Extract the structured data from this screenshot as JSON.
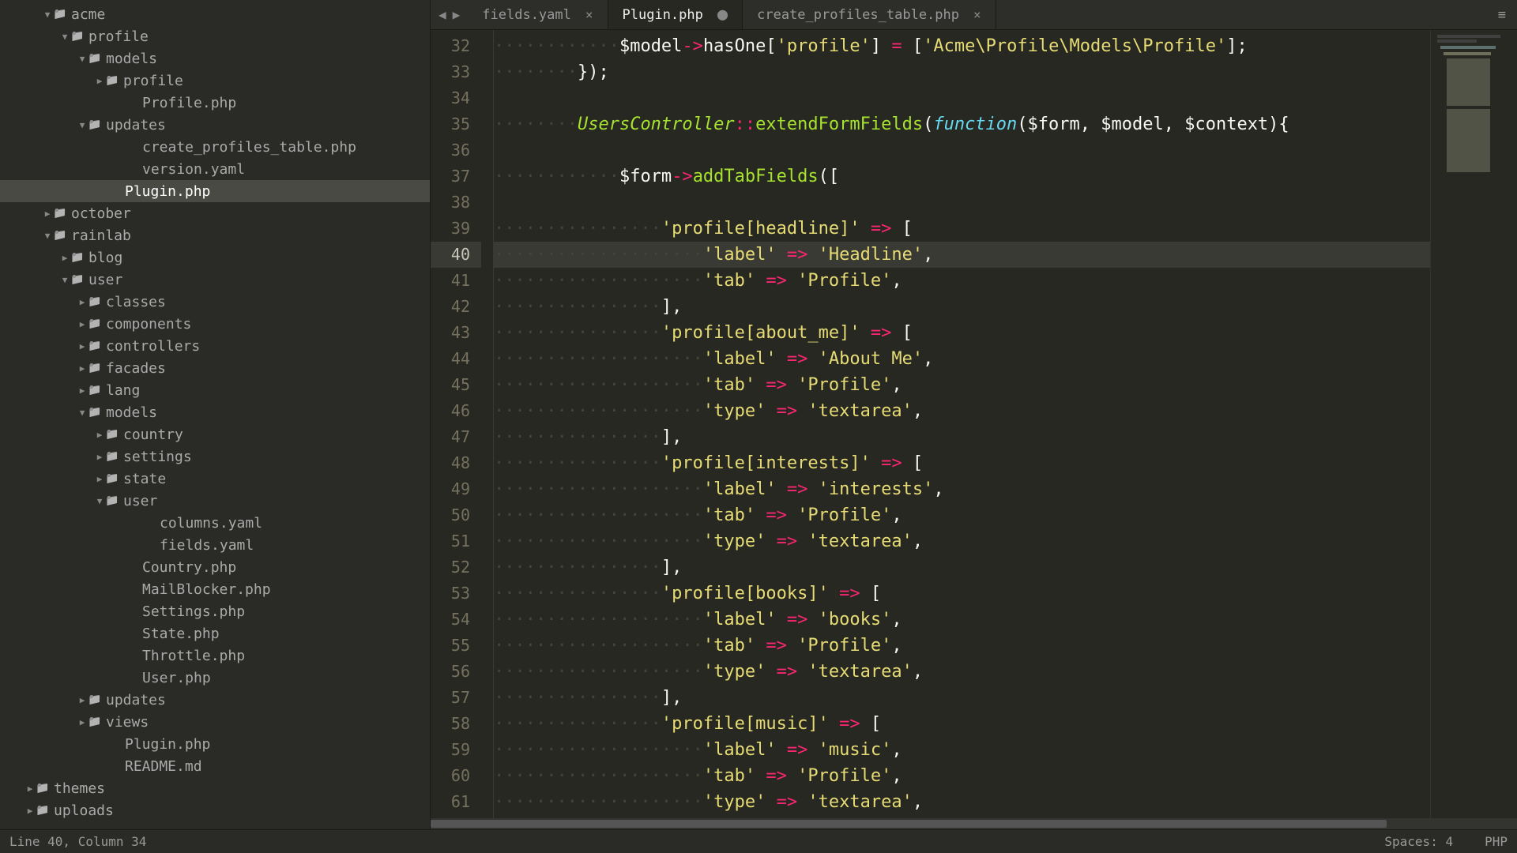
{
  "tabs": [
    {
      "label": "fields.yaml",
      "active": false,
      "dirty": false
    },
    {
      "label": "Plugin.php",
      "active": true,
      "dirty": true
    },
    {
      "label": "create_profiles_table.php",
      "active": false,
      "dirty": false
    }
  ],
  "tree": [
    {
      "indent": 54,
      "arrow": "▼",
      "type": "folder",
      "label": "acme"
    },
    {
      "indent": 76,
      "arrow": "▼",
      "type": "folder",
      "label": "profile"
    },
    {
      "indent": 98,
      "arrow": "▼",
      "type": "folder",
      "label": "models"
    },
    {
      "indent": 120,
      "arrow": "▶",
      "type": "folder",
      "label": "profile"
    },
    {
      "indent": 164,
      "arrow": "",
      "type": "file",
      "label": "Profile.php"
    },
    {
      "indent": 98,
      "arrow": "▼",
      "type": "folder",
      "label": "updates"
    },
    {
      "indent": 164,
      "arrow": "",
      "type": "file",
      "label": "create_profiles_table.php"
    },
    {
      "indent": 164,
      "arrow": "",
      "type": "file",
      "label": "version.yaml"
    },
    {
      "indent": 142,
      "arrow": "",
      "type": "file",
      "label": "Plugin.php",
      "selected": true
    },
    {
      "indent": 54,
      "arrow": "▶",
      "type": "folder",
      "label": "october"
    },
    {
      "indent": 54,
      "arrow": "▼",
      "type": "folder",
      "label": "rainlab"
    },
    {
      "indent": 76,
      "arrow": "▶",
      "type": "folder",
      "label": "blog"
    },
    {
      "indent": 76,
      "arrow": "▼",
      "type": "folder",
      "label": "user"
    },
    {
      "indent": 98,
      "arrow": "▶",
      "type": "folder",
      "label": "classes"
    },
    {
      "indent": 98,
      "arrow": "▶",
      "type": "folder",
      "label": "components"
    },
    {
      "indent": 98,
      "arrow": "▶",
      "type": "folder",
      "label": "controllers"
    },
    {
      "indent": 98,
      "arrow": "▶",
      "type": "folder",
      "label": "facades"
    },
    {
      "indent": 98,
      "arrow": "▶",
      "type": "folder",
      "label": "lang"
    },
    {
      "indent": 98,
      "arrow": "▼",
      "type": "folder",
      "label": "models"
    },
    {
      "indent": 120,
      "arrow": "▶",
      "type": "folder",
      "label": "country"
    },
    {
      "indent": 120,
      "arrow": "▶",
      "type": "folder",
      "label": "settings"
    },
    {
      "indent": 120,
      "arrow": "▶",
      "type": "folder",
      "label": "state"
    },
    {
      "indent": 120,
      "arrow": "▼",
      "type": "folder",
      "label": "user"
    },
    {
      "indent": 186,
      "arrow": "",
      "type": "file",
      "label": "columns.yaml"
    },
    {
      "indent": 186,
      "arrow": "",
      "type": "file",
      "label": "fields.yaml"
    },
    {
      "indent": 164,
      "arrow": "",
      "type": "file",
      "label": "Country.php"
    },
    {
      "indent": 164,
      "arrow": "",
      "type": "file",
      "label": "MailBlocker.php"
    },
    {
      "indent": 164,
      "arrow": "",
      "type": "file",
      "label": "Settings.php"
    },
    {
      "indent": 164,
      "arrow": "",
      "type": "file",
      "label": "State.php"
    },
    {
      "indent": 164,
      "arrow": "",
      "type": "file",
      "label": "Throttle.php"
    },
    {
      "indent": 164,
      "arrow": "",
      "type": "file",
      "label": "User.php"
    },
    {
      "indent": 98,
      "arrow": "▶",
      "type": "folder",
      "label": "updates"
    },
    {
      "indent": 98,
      "arrow": "▶",
      "type": "folder",
      "label": "views"
    },
    {
      "indent": 142,
      "arrow": "",
      "type": "file",
      "label": "Plugin.php"
    },
    {
      "indent": 142,
      "arrow": "",
      "type": "file",
      "label": "README.md"
    },
    {
      "indent": 32,
      "arrow": "▶",
      "type": "folder",
      "label": "themes"
    },
    {
      "indent": 32,
      "arrow": "▶",
      "type": "folder",
      "label": "uploads"
    }
  ],
  "code_lines": [
    {
      "n": 32,
      "seg": [
        {
          "c": "ws",
          "t": "············"
        },
        {
          "c": "s-var",
          "t": "$model"
        },
        {
          "c": "s-op",
          "t": "->"
        },
        {
          "c": "s-var",
          "t": "hasOne["
        },
        {
          "c": "s-str",
          "t": "'profile'"
        },
        {
          "c": "s-var",
          "t": "] "
        },
        {
          "c": "s-op",
          "t": "="
        },
        {
          "c": "s-var",
          "t": " ["
        },
        {
          "c": "s-str",
          "t": "'Acme\\Profile\\Models\\Profile'"
        },
        {
          "c": "s-var",
          "t": "];"
        }
      ]
    },
    {
      "n": 33,
      "seg": [
        {
          "c": "ws",
          "t": "········"
        },
        {
          "c": "s-var",
          "t": "});"
        }
      ]
    },
    {
      "n": 34,
      "seg": [
        {
          "c": "ws",
          "t": ""
        }
      ]
    },
    {
      "n": 35,
      "seg": [
        {
          "c": "ws",
          "t": "········"
        },
        {
          "c": "s-class",
          "t": "UsersController"
        },
        {
          "c": "s-op",
          "t": "::"
        },
        {
          "c": "s-func",
          "t": "extendFormFields"
        },
        {
          "c": "s-var",
          "t": "("
        },
        {
          "c": "s-kw",
          "t": "function"
        },
        {
          "c": "s-var",
          "t": "($form, $model, $context){"
        }
      ]
    },
    {
      "n": 36,
      "seg": [
        {
          "c": "ws",
          "t": ""
        }
      ]
    },
    {
      "n": 37,
      "seg": [
        {
          "c": "ws",
          "t": "············"
        },
        {
          "c": "s-var",
          "t": "$form"
        },
        {
          "c": "s-op",
          "t": "->"
        },
        {
          "c": "s-func",
          "t": "addTabFields"
        },
        {
          "c": "s-var",
          "t": "(["
        }
      ]
    },
    {
      "n": 38,
      "seg": [
        {
          "c": "ws",
          "t": ""
        }
      ]
    },
    {
      "n": 39,
      "seg": [
        {
          "c": "ws",
          "t": "················"
        },
        {
          "c": "s-str",
          "t": "'profile[headline]'"
        },
        {
          "c": "s-var",
          "t": " "
        },
        {
          "c": "s-op",
          "t": "=>"
        },
        {
          "c": "s-var",
          "t": " ["
        }
      ]
    },
    {
      "n": 40,
      "hl": true,
      "seg": [
        {
          "c": "ws",
          "t": "····················"
        },
        {
          "c": "s-str",
          "t": "'label'"
        },
        {
          "c": "s-var",
          "t": " "
        },
        {
          "c": "s-op",
          "t": "=>"
        },
        {
          "c": "s-var",
          "t": " "
        },
        {
          "c": "s-str",
          "t": "'Headline'"
        },
        {
          "c": "s-var",
          "t": ","
        }
      ]
    },
    {
      "n": 41,
      "seg": [
        {
          "c": "ws",
          "t": "····················"
        },
        {
          "c": "s-str",
          "t": "'tab'"
        },
        {
          "c": "s-var",
          "t": " "
        },
        {
          "c": "s-op",
          "t": "=>"
        },
        {
          "c": "s-var",
          "t": " "
        },
        {
          "c": "s-str",
          "t": "'Profile'"
        },
        {
          "c": "s-var",
          "t": ","
        }
      ]
    },
    {
      "n": 42,
      "seg": [
        {
          "c": "ws",
          "t": "················"
        },
        {
          "c": "s-var",
          "t": "],"
        }
      ]
    },
    {
      "n": 43,
      "seg": [
        {
          "c": "ws",
          "t": "················"
        },
        {
          "c": "s-str",
          "t": "'profile[about_me]'"
        },
        {
          "c": "s-var",
          "t": " "
        },
        {
          "c": "s-op",
          "t": "=>"
        },
        {
          "c": "s-var",
          "t": " ["
        }
      ]
    },
    {
      "n": 44,
      "seg": [
        {
          "c": "ws",
          "t": "····················"
        },
        {
          "c": "s-str",
          "t": "'label'"
        },
        {
          "c": "s-var",
          "t": " "
        },
        {
          "c": "s-op",
          "t": "=>"
        },
        {
          "c": "s-var",
          "t": " "
        },
        {
          "c": "s-str",
          "t": "'About Me'"
        },
        {
          "c": "s-var",
          "t": ","
        }
      ]
    },
    {
      "n": 45,
      "seg": [
        {
          "c": "ws",
          "t": "····················"
        },
        {
          "c": "s-str",
          "t": "'tab'"
        },
        {
          "c": "s-var",
          "t": " "
        },
        {
          "c": "s-op",
          "t": "=>"
        },
        {
          "c": "s-var",
          "t": " "
        },
        {
          "c": "s-str",
          "t": "'Profile'"
        },
        {
          "c": "s-var",
          "t": ","
        }
      ]
    },
    {
      "n": 46,
      "seg": [
        {
          "c": "ws",
          "t": "····················"
        },
        {
          "c": "s-str",
          "t": "'type'"
        },
        {
          "c": "s-var",
          "t": " "
        },
        {
          "c": "s-op",
          "t": "=>"
        },
        {
          "c": "s-var",
          "t": " "
        },
        {
          "c": "s-str",
          "t": "'textarea'"
        },
        {
          "c": "s-var",
          "t": ","
        }
      ]
    },
    {
      "n": 47,
      "seg": [
        {
          "c": "ws",
          "t": "················"
        },
        {
          "c": "s-var",
          "t": "],"
        }
      ]
    },
    {
      "n": 48,
      "seg": [
        {
          "c": "ws",
          "t": "················"
        },
        {
          "c": "s-str",
          "t": "'profile[interests]'"
        },
        {
          "c": "s-var",
          "t": " "
        },
        {
          "c": "s-op",
          "t": "=>"
        },
        {
          "c": "s-var",
          "t": " ["
        }
      ]
    },
    {
      "n": 49,
      "seg": [
        {
          "c": "ws",
          "t": "····················"
        },
        {
          "c": "s-str",
          "t": "'label'"
        },
        {
          "c": "s-var",
          "t": " "
        },
        {
          "c": "s-op",
          "t": "=>"
        },
        {
          "c": "s-var",
          "t": " "
        },
        {
          "c": "s-str",
          "t": "'interests'"
        },
        {
          "c": "s-var",
          "t": ","
        }
      ]
    },
    {
      "n": 50,
      "seg": [
        {
          "c": "ws",
          "t": "····················"
        },
        {
          "c": "s-str",
          "t": "'tab'"
        },
        {
          "c": "s-var",
          "t": " "
        },
        {
          "c": "s-op",
          "t": "=>"
        },
        {
          "c": "s-var",
          "t": " "
        },
        {
          "c": "s-str",
          "t": "'Profile'"
        },
        {
          "c": "s-var",
          "t": ","
        }
      ]
    },
    {
      "n": 51,
      "seg": [
        {
          "c": "ws",
          "t": "····················"
        },
        {
          "c": "s-str",
          "t": "'type'"
        },
        {
          "c": "s-var",
          "t": " "
        },
        {
          "c": "s-op",
          "t": "=>"
        },
        {
          "c": "s-var",
          "t": " "
        },
        {
          "c": "s-str",
          "t": "'textarea'"
        },
        {
          "c": "s-var",
          "t": ","
        }
      ]
    },
    {
      "n": 52,
      "seg": [
        {
          "c": "ws",
          "t": "················"
        },
        {
          "c": "s-var",
          "t": "],"
        }
      ]
    },
    {
      "n": 53,
      "seg": [
        {
          "c": "ws",
          "t": "················"
        },
        {
          "c": "s-str",
          "t": "'profile[books]'"
        },
        {
          "c": "s-var",
          "t": " "
        },
        {
          "c": "s-op",
          "t": "=>"
        },
        {
          "c": "s-var",
          "t": " ["
        }
      ]
    },
    {
      "n": 54,
      "seg": [
        {
          "c": "ws",
          "t": "····················"
        },
        {
          "c": "s-str",
          "t": "'label'"
        },
        {
          "c": "s-var",
          "t": " "
        },
        {
          "c": "s-op",
          "t": "=>"
        },
        {
          "c": "s-var",
          "t": " "
        },
        {
          "c": "s-str",
          "t": "'books'"
        },
        {
          "c": "s-var",
          "t": ","
        }
      ]
    },
    {
      "n": 55,
      "seg": [
        {
          "c": "ws",
          "t": "····················"
        },
        {
          "c": "s-str",
          "t": "'tab'"
        },
        {
          "c": "s-var",
          "t": " "
        },
        {
          "c": "s-op",
          "t": "=>"
        },
        {
          "c": "s-var",
          "t": " "
        },
        {
          "c": "s-str",
          "t": "'Profile'"
        },
        {
          "c": "s-var",
          "t": ","
        }
      ]
    },
    {
      "n": 56,
      "seg": [
        {
          "c": "ws",
          "t": "····················"
        },
        {
          "c": "s-str",
          "t": "'type'"
        },
        {
          "c": "s-var",
          "t": " "
        },
        {
          "c": "s-op",
          "t": "=>"
        },
        {
          "c": "s-var",
          "t": " "
        },
        {
          "c": "s-str",
          "t": "'textarea'"
        },
        {
          "c": "s-var",
          "t": ","
        }
      ]
    },
    {
      "n": 57,
      "seg": [
        {
          "c": "ws",
          "t": "················"
        },
        {
          "c": "s-var",
          "t": "],"
        }
      ]
    },
    {
      "n": 58,
      "seg": [
        {
          "c": "ws",
          "t": "················"
        },
        {
          "c": "s-str",
          "t": "'profile[music]'"
        },
        {
          "c": "s-var",
          "t": " "
        },
        {
          "c": "s-op",
          "t": "=>"
        },
        {
          "c": "s-var",
          "t": " ["
        }
      ]
    },
    {
      "n": 59,
      "seg": [
        {
          "c": "ws",
          "t": "····················"
        },
        {
          "c": "s-str",
          "t": "'label'"
        },
        {
          "c": "s-var",
          "t": " "
        },
        {
          "c": "s-op",
          "t": "=>"
        },
        {
          "c": "s-var",
          "t": " "
        },
        {
          "c": "s-str",
          "t": "'music'"
        },
        {
          "c": "s-var",
          "t": ","
        }
      ]
    },
    {
      "n": 60,
      "seg": [
        {
          "c": "ws",
          "t": "····················"
        },
        {
          "c": "s-str",
          "t": "'tab'"
        },
        {
          "c": "s-var",
          "t": " "
        },
        {
          "c": "s-op",
          "t": "=>"
        },
        {
          "c": "s-var",
          "t": " "
        },
        {
          "c": "s-str",
          "t": "'Profile'"
        },
        {
          "c": "s-var",
          "t": ","
        }
      ]
    },
    {
      "n": 61,
      "seg": [
        {
          "c": "ws",
          "t": "····················"
        },
        {
          "c": "s-str",
          "t": "'type'"
        },
        {
          "c": "s-var",
          "t": " "
        },
        {
          "c": "s-op",
          "t": "=>"
        },
        {
          "c": "s-var",
          "t": " "
        },
        {
          "c": "s-str",
          "t": "'textarea'"
        },
        {
          "c": "s-var",
          "t": ","
        }
      ]
    }
  ],
  "status": {
    "pos": "Line 40, Column 34",
    "spaces": "Spaces: 4",
    "lang": "PHP"
  }
}
